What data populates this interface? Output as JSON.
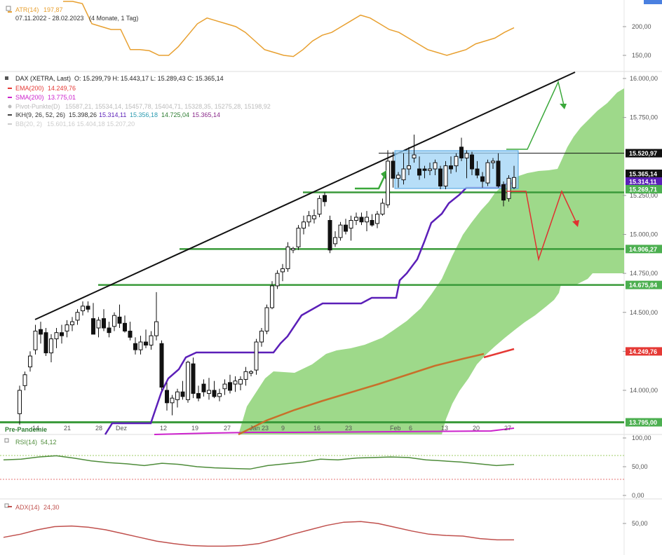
{
  "colors": {
    "up": "#ffffff",
    "down": "#111111",
    "ema": "#e53935",
    "sma": "#cc22cc",
    "kijun": "#5b1fb8",
    "cloud": "#9ed98a",
    "hline": "#3a9a3a",
    "atr": "#e8a030",
    "rsi": "#4e8c3a",
    "adx": "#c0504d",
    "trend": "#111111",
    "box": "#9fd3f5",
    "scenario_up": "#3aa83a",
    "scenario_down": "#e03030",
    "axis_text": "#555555"
  },
  "atr_panel": {
    "title": "ATR(14)",
    "value": "197,87",
    "period": "07.11.2022 - 28.02.2023",
    "period_note": "(4 Monate, 1 Tag)",
    "y_ticks": [
      "200,00",
      "150,00"
    ]
  },
  "main_panel": {
    "instrument": "DAX (XETRA, Last)",
    "ohlc": "O: 15.299,79  H: 15.443,17  L: 15.289,43  C: 15.365,14",
    "ema": "EMA(200)",
    "ema_value": "14.249,76",
    "sma": "SMA(200)",
    "sma_value": "13.775,01",
    "pivot": "Pivot-Punkte(D)",
    "pivot_values": "15587,21, 15534,14, 15457,78, 15404,71, 15328,35, 15275,28, 15198,92",
    "ikh": "IKH(9, 26, 52, 26)",
    "ikh_v1": "15.398,26",
    "ikh_v2": "15.314,11",
    "ikh_v3": "15.356,18",
    "ikh_v4": "14.725,04",
    "ikh_v5": "15.365,14",
    "bb": "BB(20, 2)",
    "bb_values": "15.601,16  15.404,18  15.207,20",
    "y_ticks": [
      "16.000,00",
      "15.750,00",
      "15.250,00",
      "15.000,00",
      "14.750,00",
      "14.500,00",
      "14.250,00",
      "14.000,00"
    ],
    "x_labels": [
      "14",
      "21",
      "28",
      "Dez",
      "12",
      "19",
      "27",
      "Jan 23",
      "9",
      "16",
      "23",
      "Feb",
      "6",
      "13",
      "20",
      "27"
    ],
    "tags": {
      "resistance": "15.520,97",
      "last": "15.365,14",
      "kijun": "15.314,11",
      "sup1": "15.269,71",
      "sup2": "14.906,27",
      "sup3": "14.675,84",
      "ema": "14.249,76",
      "sma": "13.795,00"
    },
    "pre_pandemie": "Pre-Pandemie"
  },
  "rsi_panel": {
    "title": "RSI(14)",
    "value": "54,12",
    "y_ticks": [
      "100,00",
      "50,00",
      "0,00"
    ]
  },
  "adx_panel": {
    "title": "ADX(14)",
    "value": "24,30",
    "y_ticks": [
      "50,00"
    ]
  },
  "chart_data": {
    "type": "candlestick",
    "title": "DAX (XETRA, Last)",
    "ylabel": "",
    "ylim": [
      13780,
      16050
    ],
    "candles": [
      {
        "o": 13850,
        "h": 14030,
        "l": 13780,
        "c": 14000
      },
      {
        "o": 14030,
        "h": 14120,
        "l": 14000,
        "c": 14100
      },
      {
        "o": 14150,
        "h": 14250,
        "l": 14120,
        "c": 14220
      },
      {
        "o": 14260,
        "h": 14420,
        "l": 14230,
        "c": 14380
      },
      {
        "o": 14390,
        "h": 14440,
        "l": 14300,
        "c": 14360
      },
      {
        "o": 14370,
        "h": 14400,
        "l": 14220,
        "c": 14240
      },
      {
        "o": 14240,
        "h": 14360,
        "l": 14180,
        "c": 14330
      },
      {
        "o": 14330,
        "h": 14400,
        "l": 14270,
        "c": 14370
      },
      {
        "o": 14370,
        "h": 14420,
        "l": 14300,
        "c": 14350
      },
      {
        "o": 14380,
        "h": 14450,
        "l": 14340,
        "c": 14420
      },
      {
        "o": 14420,
        "h": 14470,
        "l": 14380,
        "c": 14440
      },
      {
        "o": 14450,
        "h": 14520,
        "l": 14420,
        "c": 14500
      },
      {
        "o": 14510,
        "h": 14570,
        "l": 14480,
        "c": 14540
      },
      {
        "o": 14540,
        "h": 14570,
        "l": 14500,
        "c": 14520
      },
      {
        "o": 14460,
        "h": 14560,
        "l": 14400,
        "c": 14360
      },
      {
        "o": 14400,
        "h": 14470,
        "l": 14340,
        "c": 14450
      },
      {
        "o": 14460,
        "h": 14520,
        "l": 14380,
        "c": 14400
      },
      {
        "o": 14400,
        "h": 14440,
        "l": 14340,
        "c": 14370
      },
      {
        "o": 14410,
        "h": 14500,
        "l": 14380,
        "c": 14480
      },
      {
        "o": 14470,
        "h": 14550,
        "l": 14400,
        "c": 14430
      },
      {
        "o": 14430,
        "h": 14480,
        "l": 14370,
        "c": 14380
      },
      {
        "o": 14380,
        "h": 14440,
        "l": 14320,
        "c": 14340
      },
      {
        "o": 14300,
        "h": 14340,
        "l": 14230,
        "c": 14260
      },
      {
        "o": 14260,
        "h": 14350,
        "l": 14230,
        "c": 14310
      },
      {
        "o": 14310,
        "h": 14390,
        "l": 14270,
        "c": 14290
      },
      {
        "o": 14290,
        "h": 14380,
        "l": 14260,
        "c": 14350
      },
      {
        "o": 14350,
        "h": 14630,
        "l": 14320,
        "c": 14440
      },
      {
        "o": 14300,
        "h": 14320,
        "l": 14000,
        "c": 14020
      },
      {
        "o": 14000,
        "h": 14050,
        "l": 13870,
        "c": 13920
      },
      {
        "o": 13920,
        "h": 13970,
        "l": 13840,
        "c": 13950
      },
      {
        "o": 13940,
        "h": 14010,
        "l": 13890,
        "c": 13990
      },
      {
        "o": 13990,
        "h": 14060,
        "l": 13940,
        "c": 13960
      },
      {
        "o": 13940,
        "h": 14190,
        "l": 13920,
        "c": 14180
      },
      {
        "o": 14170,
        "h": 14210,
        "l": 13950,
        "c": 13980
      },
      {
        "o": 13980,
        "h": 14030,
        "l": 13930,
        "c": 13950
      },
      {
        "o": 14040,
        "h": 14070,
        "l": 13960,
        "c": 13990
      },
      {
        "o": 13980,
        "h": 14080,
        "l": 13940,
        "c": 14000
      },
      {
        "o": 14000,
        "h": 14060,
        "l": 13950,
        "c": 13960
      },
      {
        "o": 13960,
        "h": 14010,
        "l": 13930,
        "c": 13980
      },
      {
        "o": 14010,
        "h": 14070,
        "l": 13970,
        "c": 14040
      },
      {
        "o": 14050,
        "h": 14100,
        "l": 13980,
        "c": 14000
      },
      {
        "o": 14040,
        "h": 14090,
        "l": 13990,
        "c": 14060
      },
      {
        "o": 14040,
        "h": 14090,
        "l": 14000,
        "c": 14070
      },
      {
        "o": 14070,
        "h": 14150,
        "l": 14030,
        "c": 14120
      },
      {
        "o": 14110,
        "h": 14130,
        "l": 14090,
        "c": 14120
      },
      {
        "o": 14130,
        "h": 14330,
        "l": 14100,
        "c": 14310
      },
      {
        "o": 14310,
        "h": 14400,
        "l": 14280,
        "c": 14380
      },
      {
        "o": 14380,
        "h": 14550,
        "l": 14360,
        "c": 14530
      },
      {
        "o": 14530,
        "h": 14700,
        "l": 14520,
        "c": 14670
      },
      {
        "o": 14670,
        "h": 14770,
        "l": 14650,
        "c": 14750
      },
      {
        "o": 14760,
        "h": 14810,
        "l": 14700,
        "c": 14780
      },
      {
        "o": 14780,
        "h": 14950,
        "l": 14760,
        "c": 14920
      },
      {
        "o": 14900,
        "h": 14920,
        "l": 14880,
        "c": 14910
      },
      {
        "o": 14920,
        "h": 15060,
        "l": 14900,
        "c": 15040
      },
      {
        "o": 15040,
        "h": 15120,
        "l": 15000,
        "c": 15080
      },
      {
        "o": 15080,
        "h": 15150,
        "l": 15050,
        "c": 15120
      },
      {
        "o": 15100,
        "h": 15160,
        "l": 15070,
        "c": 15120
      },
      {
        "o": 15130,
        "h": 15250,
        "l": 15110,
        "c": 15230
      },
      {
        "o": 15250,
        "h": 15270,
        "l": 15180,
        "c": 15210
      },
      {
        "o": 15090,
        "h": 15120,
        "l": 14880,
        "c": 14900
      },
      {
        "o": 14940,
        "h": 15020,
        "l": 14920,
        "c": 14980
      },
      {
        "o": 14980,
        "h": 15080,
        "l": 14960,
        "c": 15060
      },
      {
        "o": 15060,
        "h": 15100,
        "l": 15000,
        "c": 15020
      },
      {
        "o": 15040,
        "h": 15120,
        "l": 14960,
        "c": 15090
      },
      {
        "o": 15090,
        "h": 15140,
        "l": 15060,
        "c": 15110
      },
      {
        "o": 15110,
        "h": 15140,
        "l": 15060,
        "c": 15080
      },
      {
        "o": 15080,
        "h": 15150,
        "l": 15020,
        "c": 15110
      },
      {
        "o": 15090,
        "h": 15130,
        "l": 15050,
        "c": 15060
      },
      {
        "o": 15070,
        "h": 15150,
        "l": 15040,
        "c": 15130
      },
      {
        "o": 15130,
        "h": 15230,
        "l": 15120,
        "c": 15200
      },
      {
        "o": 15190,
        "h": 15540,
        "l": 15170,
        "c": 15470
      },
      {
        "o": 15470,
        "h": 15530,
        "l": 15300,
        "c": 15360
      },
      {
        "o": 15360,
        "h": 15400,
        "l": 15300,
        "c": 15380
      },
      {
        "o": 15350,
        "h": 15520,
        "l": 15320,
        "c": 15420
      },
      {
        "o": 15420,
        "h": 15560,
        "l": 15380,
        "c": 15440
      },
      {
        "o": 15490,
        "h": 15640,
        "l": 15460,
        "c": 15510
      },
      {
        "o": 15420,
        "h": 15500,
        "l": 15350,
        "c": 15380
      },
      {
        "o": 15420,
        "h": 15440,
        "l": 15360,
        "c": 15410
      },
      {
        "o": 15410,
        "h": 15460,
        "l": 15380,
        "c": 15420
      },
      {
        "o": 15420,
        "h": 15480,
        "l": 15380,
        "c": 15460
      },
      {
        "o": 15420,
        "h": 15440,
        "l": 15290,
        "c": 15310
      },
      {
        "o": 15310,
        "h": 15470,
        "l": 15290,
        "c": 15440
      },
      {
        "o": 15440,
        "h": 15500,
        "l": 15390,
        "c": 15420
      },
      {
        "o": 15440,
        "h": 15520,
        "l": 15400,
        "c": 15500
      },
      {
        "o": 15560,
        "h": 15620,
        "l": 15470,
        "c": 15490
      },
      {
        "o": 15490,
        "h": 15540,
        "l": 15360,
        "c": 15520
      },
      {
        "o": 15510,
        "h": 15530,
        "l": 15380,
        "c": 15420
      },
      {
        "o": 15420,
        "h": 15470,
        "l": 15360,
        "c": 15380
      },
      {
        "o": 15370,
        "h": 15400,
        "l": 15300,
        "c": 15340
      },
      {
        "o": 15330,
        "h": 15480,
        "l": 15310,
        "c": 15460
      },
      {
        "o": 15460,
        "h": 15490,
        "l": 15420,
        "c": 15470
      },
      {
        "o": 15470,
        "h": 15520,
        "l": 15300,
        "c": 15310
      },
      {
        "o": 15320,
        "h": 15340,
        "l": 15180,
        "c": 15220
      },
      {
        "o": 15230,
        "h": 15380,
        "l": 15210,
        "c": 15360
      },
      {
        "o": 15300,
        "h": 15440,
        "l": 15290,
        "c": 15365
      }
    ],
    "horizontal_levels": [
      15520.97,
      15269.71,
      14906.27,
      14675.84,
      13795.0
    ],
    "series": [
      {
        "name": "EMA(200)",
        "values": [
          13960,
          13980,
          14000,
          14030,
          14060,
          14100,
          14140,
          14180,
          14220,
          14249.76
        ]
      },
      {
        "name": "IKH(9, 26, 52, 26)",
        "values": [
          13800,
          14100,
          14230,
          14230,
          14290,
          14520,
          14570,
          14750,
          15230,
          15314.11
        ]
      }
    ],
    "atr": [
      260,
      250,
      240,
      205,
      200,
      195,
      195,
      160,
      160,
      158,
      150,
      150,
      165,
      185,
      205,
      215,
      210,
      205,
      200,
      190,
      175,
      160,
      155,
      150,
      148,
      160,
      175,
      185,
      190,
      200,
      210,
      220,
      215,
      205,
      195,
      190,
      180,
      170,
      160,
      155,
      150,
      155,
      160,
      170,
      175,
      180,
      190,
      198
    ],
    "rsi": [
      62,
      63,
      67,
      69,
      65,
      60,
      57,
      55,
      52,
      56,
      54,
      50,
      48,
      47,
      46,
      52,
      55,
      58,
      63,
      62,
      65,
      66,
      67,
      66,
      62,
      60,
      58,
      55,
      52,
      54
    ],
    "adx": [
      28,
      33,
      40,
      45,
      46,
      44,
      40,
      34,
      28,
      22,
      18,
      15,
      14,
      14,
      15,
      18,
      25,
      33,
      40,
      47,
      52,
      53,
      50,
      44,
      38,
      33,
      31,
      30,
      26,
      24,
      24
    ]
  }
}
